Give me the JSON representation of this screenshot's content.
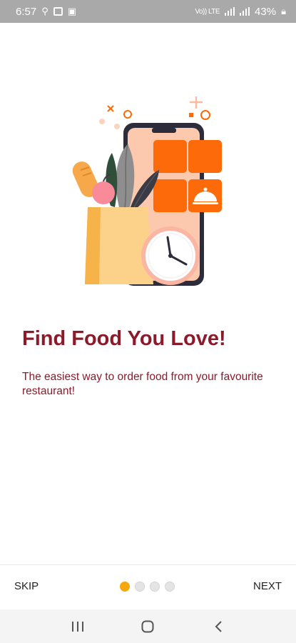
{
  "status_bar": {
    "time": "6:57",
    "network_text": "Vo)) LTE",
    "battery": "43%",
    "left_icons": [
      "nearby-share-icon",
      "screen-icon",
      "image-icon"
    ],
    "right_icons": [
      "volte-icon",
      "signal-icon",
      "signal-icon",
      "battery-lock-icon"
    ]
  },
  "onboarding": {
    "title": "Find Food You Love!",
    "subtitle": "The easiest way to order food from your favourite restaurant!",
    "illustration": "phone-groceries-clock-illustration",
    "page_index": 1,
    "page_count": 4
  },
  "footer": {
    "skip_label": "SKIP",
    "next_label": "NEXT"
  },
  "colors": {
    "title": "#8b1a2b",
    "accent_orange": "#fd6a09",
    "dot_active": "#f6a70e",
    "dot_inactive": "#e4e4e4"
  },
  "nav_bar": {
    "icons": [
      "recent-apps-icon",
      "home-icon",
      "back-icon"
    ]
  }
}
